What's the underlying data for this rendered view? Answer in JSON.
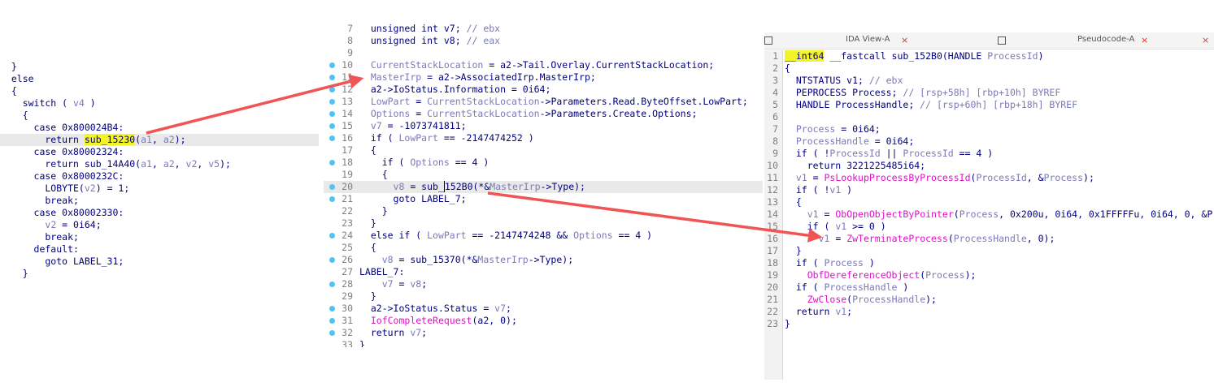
{
  "left_panel": {
    "lines": [
      {
        "parts": [
          {
            "t": "  }"
          }
        ]
      },
      {
        "parts": [
          {
            "t": "  else"
          }
        ]
      },
      {
        "parts": [
          {
            "t": "  {"
          }
        ]
      },
      {
        "parts": [
          {
            "t": "    switch ( "
          },
          {
            "t": "v4",
            "c": "var"
          },
          {
            "t": " )"
          }
        ]
      },
      {
        "parts": [
          {
            "t": "    {"
          }
        ]
      },
      {
        "parts": [
          {
            "t": "      case 0x800024B4:"
          }
        ]
      },
      {
        "parts": [
          {
            "t": "        return "
          },
          {
            "t": "sub_15230",
            "c": "sel"
          },
          {
            "t": "("
          },
          {
            "t": "a1",
            "c": "var"
          },
          {
            "t": ", "
          },
          {
            "t": "a2",
            "c": "var"
          },
          {
            "t": ");"
          }
        ],
        "highlight": true
      },
      {
        "parts": [
          {
            "t": "      case 0x80002324:"
          }
        ]
      },
      {
        "parts": [
          {
            "t": "        return sub_14A40("
          },
          {
            "t": "a1",
            "c": "var"
          },
          {
            "t": ", "
          },
          {
            "t": "a2",
            "c": "var"
          },
          {
            "t": ", "
          },
          {
            "t": "v2",
            "c": "var"
          },
          {
            "t": ", "
          },
          {
            "t": "v5",
            "c": "var"
          },
          {
            "t": ");"
          }
        ]
      },
      {
        "parts": [
          {
            "t": "      case 0x8000232C:"
          }
        ]
      },
      {
        "parts": [
          {
            "t": "        LOBYTE("
          },
          {
            "t": "v2",
            "c": "var"
          },
          {
            "t": ") = 1;"
          }
        ]
      },
      {
        "parts": [
          {
            "t": "        break;"
          }
        ]
      },
      {
        "parts": [
          {
            "t": "      case 0x80002330:"
          }
        ]
      },
      {
        "parts": [
          {
            "t": "        "
          },
          {
            "t": "v2",
            "c": "var"
          },
          {
            "t": " = 0i64;"
          }
        ]
      },
      {
        "parts": [
          {
            "t": "        break;"
          }
        ]
      },
      {
        "parts": [
          {
            "t": "      default:"
          }
        ]
      },
      {
        "parts": [
          {
            "t": "        goto LABEL_31;"
          }
        ]
      },
      {
        "parts": [
          {
            "t": "    }"
          }
        ]
      }
    ]
  },
  "mid_panel": {
    "lines": [
      {
        "num": "7",
        "parts": [
          {
            "t": "  unsigned int v7; "
          },
          {
            "t": "// ebx",
            "c": "cmt"
          }
        ]
      },
      {
        "num": "8",
        "parts": [
          {
            "t": "  unsigned int v8; "
          },
          {
            "t": "// eax",
            "c": "cmt"
          }
        ]
      },
      {
        "num": "9",
        "parts": [
          {
            "t": ""
          }
        ]
      },
      {
        "num": "10",
        "bp": true,
        "parts": [
          {
            "t": "  "
          },
          {
            "t": "CurrentStackLocation",
            "c": "var"
          },
          {
            "t": " = a2->Tail.Overlay.CurrentStackLocation;"
          }
        ]
      },
      {
        "num": "11",
        "bp": true,
        "parts": [
          {
            "t": "  "
          },
          {
            "t": "MasterIrp",
            "c": "var"
          },
          {
            "t": " = a2->AssociatedIrp.MasterIrp;"
          }
        ]
      },
      {
        "num": "12",
        "bp": true,
        "parts": [
          {
            "t": "  a2->IoStatus.Information = 0i64;"
          }
        ]
      },
      {
        "num": "13",
        "bp": true,
        "parts": [
          {
            "t": "  "
          },
          {
            "t": "LowPart",
            "c": "var"
          },
          {
            "t": " = "
          },
          {
            "t": "CurrentStackLocation",
            "c": "var"
          },
          {
            "t": "->Parameters.Read.ByteOffset.LowPart;"
          }
        ]
      },
      {
        "num": "14",
        "bp": true,
        "parts": [
          {
            "t": "  "
          },
          {
            "t": "Options",
            "c": "var"
          },
          {
            "t": " = "
          },
          {
            "t": "CurrentStackLocation",
            "c": "var"
          },
          {
            "t": "->Parameters.Create.Options;"
          }
        ]
      },
      {
        "num": "15",
        "bp": true,
        "parts": [
          {
            "t": "  "
          },
          {
            "t": "v7",
            "c": "var"
          },
          {
            "t": " = -1073741811;"
          }
        ]
      },
      {
        "num": "16",
        "bp": true,
        "parts": [
          {
            "t": "  if ( "
          },
          {
            "t": "LowPart",
            "c": "var"
          },
          {
            "t": " == -2147474252 )"
          }
        ]
      },
      {
        "num": "17",
        "parts": [
          {
            "t": "  {"
          }
        ]
      },
      {
        "num": "18",
        "bp": true,
        "parts": [
          {
            "t": "    if ( "
          },
          {
            "t": "Options",
            "c": "var"
          },
          {
            "t": " == 4 )"
          }
        ]
      },
      {
        "num": "19",
        "parts": [
          {
            "t": "    {"
          }
        ]
      },
      {
        "num": "20",
        "bp": true,
        "highlight": true,
        "parts": [
          {
            "t": "      "
          },
          {
            "t": "v8",
            "c": "var"
          },
          {
            "t": " = sub_"
          },
          {
            "t": "152B0(*&",
            "c": "cursor"
          },
          {
            "t": "MasterIrp",
            "c": "var"
          },
          {
            "t": "->Type);"
          }
        ]
      },
      {
        "num": "21",
        "bp": true,
        "parts": [
          {
            "t": "      goto LABEL_7;"
          }
        ]
      },
      {
        "num": "22",
        "parts": [
          {
            "t": "    }"
          }
        ]
      },
      {
        "num": "23",
        "parts": [
          {
            "t": "  }"
          }
        ]
      },
      {
        "num": "24",
        "bp": true,
        "parts": [
          {
            "t": "  else if ( "
          },
          {
            "t": "LowPart",
            "c": "var"
          },
          {
            "t": " == -2147474248 && "
          },
          {
            "t": "Options",
            "c": "var"
          },
          {
            "t": " == 4 )"
          }
        ]
      },
      {
        "num": "25",
        "parts": [
          {
            "t": "  {"
          }
        ]
      },
      {
        "num": "26",
        "bp": true,
        "parts": [
          {
            "t": "    "
          },
          {
            "t": "v8",
            "c": "var"
          },
          {
            "t": " = sub_15370(*&"
          },
          {
            "t": "MasterIrp",
            "c": "var"
          },
          {
            "t": "->Type);"
          }
        ]
      },
      {
        "num": "27",
        "parts": [
          {
            "t": "LABEL_7:"
          }
        ]
      },
      {
        "num": "28",
        "bp": true,
        "parts": [
          {
            "t": "    "
          },
          {
            "t": "v7",
            "c": "var"
          },
          {
            "t": " = "
          },
          {
            "t": "v8",
            "c": "var"
          },
          {
            "t": ";"
          }
        ]
      },
      {
        "num": "29",
        "parts": [
          {
            "t": "  }"
          }
        ]
      },
      {
        "num": "30",
        "bp": true,
        "parts": [
          {
            "t": "  a2->IoStatus.Status = "
          },
          {
            "t": "v7",
            "c": "var"
          },
          {
            "t": ";"
          }
        ]
      },
      {
        "num": "31",
        "bp": true,
        "parts": [
          {
            "t": "  "
          },
          {
            "t": "IofCompleteRequest",
            "c": "fn"
          },
          {
            "t": "(a2, 0);"
          }
        ]
      },
      {
        "num": "32",
        "bp": true,
        "parts": [
          {
            "t": "  return "
          },
          {
            "t": "v7",
            "c": "var"
          },
          {
            "t": ";"
          }
        ]
      },
      {
        "num": "33",
        "parts": [
          {
            "t": "}"
          }
        ]
      }
    ]
  },
  "right_panel": {
    "tabs": [
      {
        "label": "IDA View-A"
      },
      {
        "label": "Pseudocode-A"
      }
    ],
    "lines": [
      {
        "num": "1",
        "parts": [
          {
            "t": "__int64",
            "c": "sel"
          },
          {
            "t": " __fastcall sub_152B0(HANDLE "
          },
          {
            "t": "ProcessId",
            "c": "var"
          },
          {
            "t": ")"
          }
        ]
      },
      {
        "num": "2",
        "parts": [
          {
            "t": "{"
          }
        ]
      },
      {
        "num": "3",
        "parts": [
          {
            "t": "  NTSTATUS v1; "
          },
          {
            "t": "// ebx",
            "c": "cmt"
          }
        ]
      },
      {
        "num": "4",
        "parts": [
          {
            "t": "  PEPROCESS Process; "
          },
          {
            "t": "// [rsp+58h] [rbp+10h] BYREF",
            "c": "cmt"
          }
        ]
      },
      {
        "num": "5",
        "parts": [
          {
            "t": "  HANDLE ProcessHandle; "
          },
          {
            "t": "// [rsp+60h] [rbp+18h] BYREF",
            "c": "cmt"
          }
        ]
      },
      {
        "num": "6",
        "parts": [
          {
            "t": ""
          }
        ]
      },
      {
        "num": "7",
        "parts": [
          {
            "t": "  "
          },
          {
            "t": "Process",
            "c": "var"
          },
          {
            "t": " = 0i64;"
          }
        ]
      },
      {
        "num": "8",
        "parts": [
          {
            "t": "  "
          },
          {
            "t": "ProcessHandle",
            "c": "var"
          },
          {
            "t": " = 0i64;"
          }
        ]
      },
      {
        "num": "9",
        "parts": [
          {
            "t": "  if ( !"
          },
          {
            "t": "ProcessId",
            "c": "var"
          },
          {
            "t": " || "
          },
          {
            "t": "ProcessId",
            "c": "var"
          },
          {
            "t": " == 4 )"
          }
        ]
      },
      {
        "num": "10",
        "parts": [
          {
            "t": "    return 3221225485i64;"
          }
        ]
      },
      {
        "num": "11",
        "parts": [
          {
            "t": "  "
          },
          {
            "t": "v1",
            "c": "var"
          },
          {
            "t": " = "
          },
          {
            "t": "PsLookupProcessByProcessId",
            "c": "fn"
          },
          {
            "t": "("
          },
          {
            "t": "ProcessId",
            "c": "var"
          },
          {
            "t": ", &"
          },
          {
            "t": "Process",
            "c": "var"
          },
          {
            "t": ");"
          }
        ]
      },
      {
        "num": "12",
        "parts": [
          {
            "t": "  if ( !"
          },
          {
            "t": "v1",
            "c": "var"
          },
          {
            "t": " )"
          }
        ]
      },
      {
        "num": "13",
        "parts": [
          {
            "t": "  {"
          }
        ]
      },
      {
        "num": "14",
        "parts": [
          {
            "t": "    "
          },
          {
            "t": "v1",
            "c": "var"
          },
          {
            "t": " = "
          },
          {
            "t": "ObOpenObjectByPointer",
            "c": "fn"
          },
          {
            "t": "("
          },
          {
            "t": "Process",
            "c": "var"
          },
          {
            "t": ", 0x200u, 0i64, 0x1FFFFFu, 0i64, 0, &P"
          }
        ]
      },
      {
        "num": "15",
        "parts": [
          {
            "t": "    if ( "
          },
          {
            "t": "v1",
            "c": "var"
          },
          {
            "t": " >= 0 )"
          }
        ]
      },
      {
        "num": "16",
        "parts": [
          {
            "t": "      "
          },
          {
            "t": "v1",
            "c": "var"
          },
          {
            "t": " = "
          },
          {
            "t": "ZwTerminateProcess",
            "c": "fn"
          },
          {
            "t": "("
          },
          {
            "t": "ProcessHandle",
            "c": "var"
          },
          {
            "t": ", 0);"
          }
        ]
      },
      {
        "num": "17",
        "parts": [
          {
            "t": "  }"
          }
        ]
      },
      {
        "num": "18",
        "parts": [
          {
            "t": "  if ( "
          },
          {
            "t": "Process",
            "c": "var"
          },
          {
            "t": " )"
          }
        ]
      },
      {
        "num": "19",
        "parts": [
          {
            "t": "    "
          },
          {
            "t": "ObfDereferenceObject",
            "c": "fn"
          },
          {
            "t": "("
          },
          {
            "t": "Process",
            "c": "var"
          },
          {
            "t": ");"
          }
        ]
      },
      {
        "num": "20",
        "parts": [
          {
            "t": "  if ( "
          },
          {
            "t": "ProcessHandle",
            "c": "var"
          },
          {
            "t": " )"
          }
        ]
      },
      {
        "num": "21",
        "parts": [
          {
            "t": "    "
          },
          {
            "t": "ZwClose",
            "c": "fn"
          },
          {
            "t": "("
          },
          {
            "t": "ProcessHandle",
            "c": "var"
          },
          {
            "t": ");"
          }
        ]
      },
      {
        "num": "22",
        "parts": [
          {
            "t": "  return "
          },
          {
            "t": "v1",
            "c": "var"
          },
          {
            "t": ";"
          }
        ]
      },
      {
        "num": "23",
        "parts": [
          {
            "t": "}"
          }
        ]
      }
    ]
  },
  "colors": {
    "arrow": "#f05454",
    "breakpoint": "#4fc3f7",
    "selection": "#f3f32a",
    "function": "#e010c8",
    "variable": "#7a7ab8",
    "code": "#000080"
  }
}
